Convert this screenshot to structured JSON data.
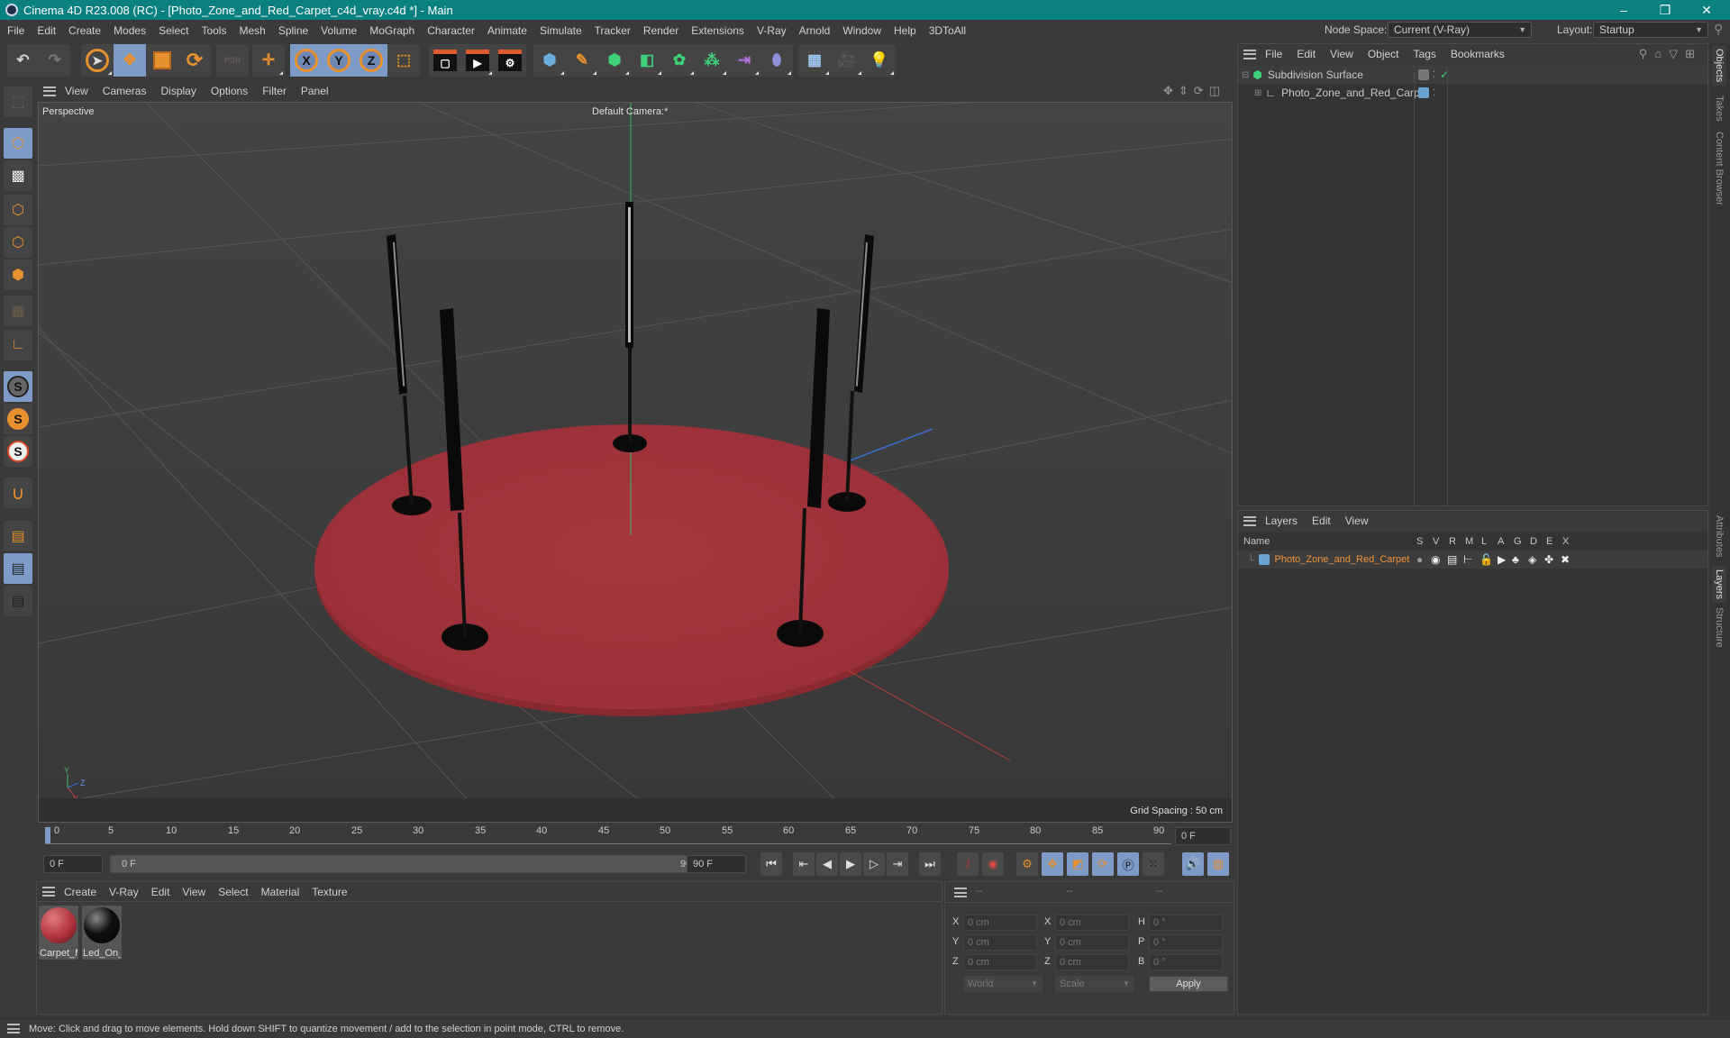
{
  "window": {
    "title": "Cinema 4D R23.008 (RC) - [Photo_Zone_and_Red_Carpet_c4d_vray.c4d *] - Main",
    "controls": {
      "minimize": "–",
      "maximize": "❐",
      "close": "✕"
    }
  },
  "menubar": {
    "items": [
      "File",
      "Edit",
      "Create",
      "Modes",
      "Select",
      "Tools",
      "Mesh",
      "Spline",
      "Volume",
      "MoGraph",
      "Character",
      "Animate",
      "Simulate",
      "Tracker",
      "Render",
      "Extensions",
      "V-Ray",
      "Arnold",
      "Window",
      "Help",
      "3DToAll"
    ],
    "node_space_label": "Node Space:",
    "node_space_value": "Current (V-Ray)",
    "layout_label": "Layout:",
    "layout_value": "Startup"
  },
  "toolbar": {
    "undo": "undo-icon",
    "redo": "redo-icon",
    "tools": [
      "select-icon",
      "move-icon",
      "scale-icon",
      "rotate-icon",
      "psr-icon",
      "live-move-icon"
    ],
    "axes": [
      "X",
      "Y",
      "Z"
    ],
    "coord_system": "world-coord-icon",
    "render": [
      "render-view-icon",
      "render-picture-viewer-icon",
      "render-settings-icon"
    ],
    "objects": [
      "cube-icon",
      "pen-icon",
      "subdivision-icon",
      "extrude-icon",
      "cloner-icon",
      "mograph-icon",
      "symmetry-icon",
      "deformer-icon",
      "floor-icon",
      "camera-icon",
      "light-icon"
    ]
  },
  "viewport": {
    "menu": [
      "View",
      "Cameras",
      "Display",
      "Options",
      "Filter",
      "Panel"
    ],
    "view_name": "Perspective",
    "camera": "Default Camera",
    "camera_suffix": ":*",
    "grid_spacing": "Grid Spacing : 50 cm",
    "axis_labels": {
      "y": "Y",
      "z": "Z",
      "x": "X"
    }
  },
  "timeline": {
    "ticks": [
      "0",
      "5",
      "10",
      "15",
      "20",
      "25",
      "30",
      "35",
      "40",
      "45",
      "50",
      "55",
      "60",
      "65",
      "70",
      "75",
      "80",
      "85",
      "90"
    ],
    "current_frame_field": "0 F",
    "start_field": "0 F",
    "range_start": "0 F",
    "range_end": "90 F",
    "end_field": "90 F",
    "right_frame_field": "0 F"
  },
  "materials": {
    "menu": [
      "Create",
      "V-Ray",
      "Edit",
      "View",
      "Select",
      "Material",
      "Texture"
    ],
    "items": [
      {
        "name": "Carpet_M",
        "color": "#b0333d"
      },
      {
        "name": "Led_On_",
        "color": "#0c0c0c"
      }
    ]
  },
  "coordinates": {
    "headers": [
      "--",
      "--",
      "--"
    ],
    "rows": [
      {
        "l1": "X",
        "v1": "0 cm",
        "l2": "X",
        "v2": "0 cm",
        "l3": "H",
        "v3": "0 °"
      },
      {
        "l1": "Y",
        "v1": "0 cm",
        "l2": "Y",
        "v2": "0 cm",
        "l3": "P",
        "v3": "0 °"
      },
      {
        "l1": "Z",
        "v1": "0 cm",
        "l2": "Z",
        "v2": "0 cm",
        "l3": "B",
        "v3": "0 °"
      }
    ],
    "mode_select": "World",
    "type_select": "Scale",
    "apply_label": "Apply"
  },
  "objects_panel": {
    "menu": [
      "File",
      "Edit",
      "View",
      "Object",
      "Tags",
      "Bookmarks"
    ],
    "items": [
      {
        "name": "Subdivision Surface",
        "indent": 0
      },
      {
        "name": "Photo_Zone_and_Red_Carpet",
        "indent": 1
      }
    ]
  },
  "layers_panel": {
    "menu": [
      "Layers",
      "Edit",
      "View"
    ],
    "columns": [
      "Name",
      "S",
      "V",
      "R",
      "M",
      "L",
      "A",
      "G",
      "D",
      "E",
      "X"
    ],
    "items": [
      {
        "name": "Photo_Zone_and_Red_Carpet",
        "color": "#6aa3d0"
      }
    ]
  },
  "right_tabs": {
    "top": [
      "Objects",
      "Takes",
      "Content Browser"
    ],
    "bottom": [
      "Attributes",
      "Layers",
      "Structure"
    ]
  },
  "status": {
    "text": "Move: Click and drag to move elements. Hold down SHIFT to quantize movement / add to the selection in point mode, CTRL to remove."
  },
  "colors": {
    "title_bar": "#0a8080",
    "accent_blue": "#7e9bc7",
    "accent_orange": "#e7902e",
    "layer_name": "#f0923b",
    "carpet": "#a8363e"
  }
}
